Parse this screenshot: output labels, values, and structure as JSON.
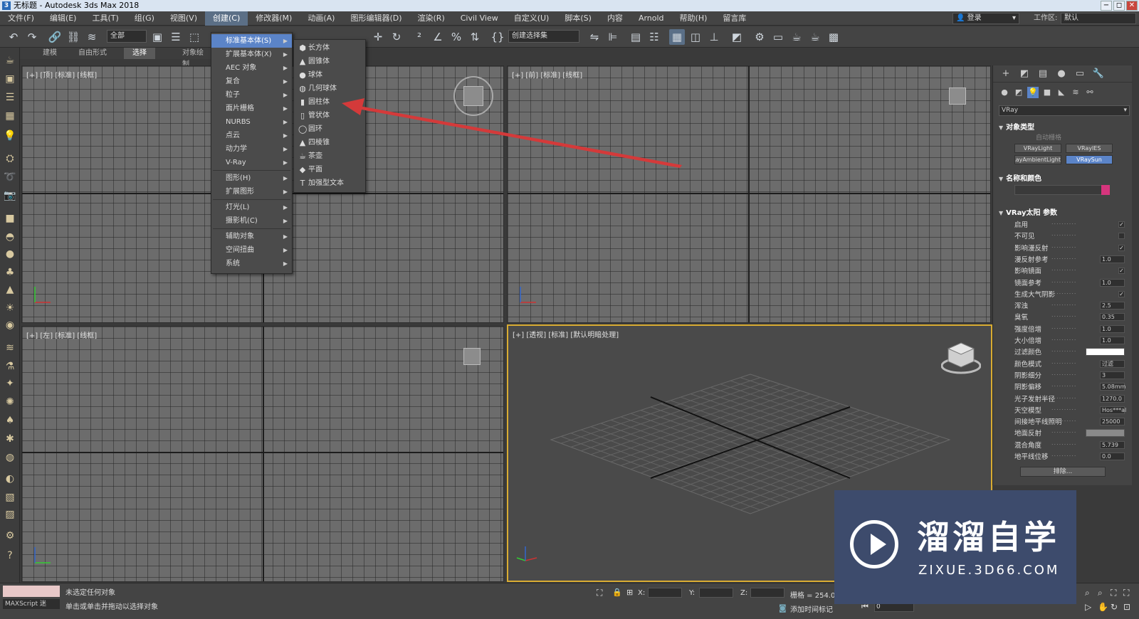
{
  "titlebar": {
    "icon": "3",
    "title": "无标题 - Autodesk 3ds Max 2018",
    "min": "−",
    "max": "◻",
    "close": "✕"
  },
  "menubar": {
    "items": [
      "文件(F)",
      "编辑(E)",
      "工具(T)",
      "组(G)",
      "视图(V)",
      "创建(C)",
      "修改器(M)",
      "动画(A)",
      "图形编辑器(D)",
      "渲染(R)",
      "Civil View",
      "自定义(U)",
      "脚本(S)",
      "内容",
      "Arnold",
      "帮助(H)",
      "留言库"
    ],
    "login": "登录",
    "workspace_label": "工作区:",
    "workspace_value": "默认"
  },
  "toolbar": {
    "filter": "全部",
    "selection_set": "创建选择集"
  },
  "ribbon": {
    "tabs": [
      "建模",
      "自由形式",
      "选择",
      "对象绘制"
    ]
  },
  "viewports": {
    "top": "[+] [顶] [标准] [线框]",
    "front": "[+] [前] [标准] [线框]",
    "left": "[+] [左] [标准] [线框]",
    "persp": "[+] [透视] [标准] [默认明暗处理]"
  },
  "create_menu": {
    "items": [
      "标准基本体(S)",
      "扩展基本体(X)",
      "AEC 对象",
      "复合",
      "粒子",
      "面片栅格",
      "NURBS",
      "点云",
      "动力学",
      "V-Ray",
      "图形(H)",
      "扩展图形",
      "灯光(L)",
      "摄影机(C)",
      "辅助对象",
      "空间扭曲",
      "系统"
    ]
  },
  "primitives_menu": {
    "items": [
      "长方体",
      "圆锥体",
      "球体",
      "几何球体",
      "圆柱体",
      "管状体",
      "圆环",
      "四棱锥",
      "茶壶",
      "平面",
      "加强型文本"
    ]
  },
  "command_panel": {
    "renderer": "VRay",
    "object_type_title": "对象类型",
    "autogrid": "自动栅格",
    "buttons": [
      "VRayLight",
      "VRayIES",
      "VRayAmbientLight",
      "VRaySun"
    ],
    "name_color_title": "名称和颜色",
    "swatch_color": "#d6357d",
    "params_title": "VRay太阳 参数",
    "params": [
      {
        "label": "启用",
        "type": "check",
        "value": "✓"
      },
      {
        "label": "不可见",
        "type": "check",
        "value": ""
      },
      {
        "label": "影响漫反射",
        "type": "check",
        "value": "✓"
      },
      {
        "label": "漫反射参考",
        "type": "num",
        "value": "1.0"
      },
      {
        "label": "影响镜面",
        "type": "check",
        "value": "✓"
      },
      {
        "label": "镜面参考",
        "type": "num",
        "value": "1.0"
      },
      {
        "label": "生成大气阴影",
        "type": "check",
        "value": "✓"
      },
      {
        "label": "浑浊",
        "type": "num",
        "value": "2.5"
      },
      {
        "label": "臭氧",
        "type": "num",
        "value": "0.35"
      },
      {
        "label": "强度倍增",
        "type": "num",
        "value": "1.0"
      },
      {
        "label": "大小倍增",
        "type": "num",
        "value": "1.0"
      },
      {
        "label": "过滤颜色",
        "type": "swatch",
        "value": ""
      },
      {
        "label": "颜色模式",
        "type": "num",
        "value": "过滤"
      },
      {
        "label": "阴影细分",
        "type": "num",
        "value": "3"
      },
      {
        "label": "阴影偏移",
        "type": "num",
        "value": "5.08mm"
      },
      {
        "label": "光子发射半径",
        "type": "num",
        "value": "1270.0"
      },
      {
        "label": "天空模型",
        "type": "num",
        "value": "Hos***al"
      },
      {
        "label": "间接地平线照明",
        "type": "num",
        "value": "25000"
      },
      {
        "label": "地面反射",
        "type": "swatch",
        "value": ""
      },
      {
        "label": "混合角度",
        "type": "num",
        "value": "5.739"
      },
      {
        "label": "地平线位移",
        "type": "num",
        "value": "0.0"
      }
    ],
    "exclude": "排除..."
  },
  "status": {
    "maxscript": "MAXScript 迷",
    "line1": "未选定任何对象",
    "line2": "单击或单击并拖动以选择对象",
    "x_label": "X:",
    "y_label": "Y:",
    "z_label": "Z:",
    "grid": "栅格 = 254.0",
    "add_time_tag": "添加时间标记",
    "frame": "0"
  },
  "watermark": {
    "title": "溜溜自学",
    "url": "ZIXUE.3D66.COM"
  },
  "colors": {
    "accent_blue": "#5b84c8",
    "arrow_red": "#d43a3a",
    "viewport_active": "#d9ac32"
  }
}
